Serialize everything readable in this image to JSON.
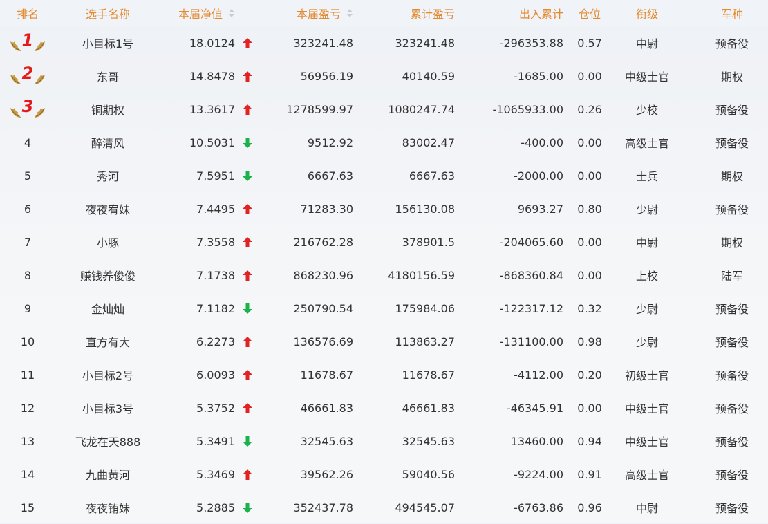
{
  "headers": {
    "rank": "排名",
    "name": "选手名称",
    "nav": "本届净值",
    "current_profit": "本届盈亏",
    "cumulative_profit": "累计盈亏",
    "flow": "出入累计",
    "position": "仓位",
    "military_rank": "衔级",
    "branch": "军种"
  },
  "colors": {
    "accent": "#e48a2e",
    "up": "#e02424",
    "down": "#1bb24b",
    "medal": "#e21a1a"
  },
  "rows": [
    {
      "rank": "1",
      "name": "小目标1号",
      "nav": "18.0124",
      "trend": "up",
      "current_profit": "323241.48",
      "cumulative_profit": "323241.48",
      "flow": "-296353.88",
      "position": "0.57",
      "military_rank": "中尉",
      "branch": "预备役"
    },
    {
      "rank": "2",
      "name": "东哥",
      "nav": "14.8478",
      "trend": "up",
      "current_profit": "56956.19",
      "cumulative_profit": "40140.59",
      "flow": "-1685.00",
      "position": "0.00",
      "military_rank": "中级士官",
      "branch": "期权"
    },
    {
      "rank": "3",
      "name": "铜期权",
      "nav": "13.3617",
      "trend": "up",
      "current_profit": "1278599.97",
      "cumulative_profit": "1080247.74",
      "flow": "-1065933.00",
      "position": "0.26",
      "military_rank": "少校",
      "branch": "预备役"
    },
    {
      "rank": "4",
      "name": "醉清风",
      "nav": "10.5031",
      "trend": "down",
      "current_profit": "9512.92",
      "cumulative_profit": "83002.47",
      "flow": "-400.00",
      "position": "0.00",
      "military_rank": "高级士官",
      "branch": "预备役"
    },
    {
      "rank": "5",
      "name": "秀河",
      "nav": "7.5951",
      "trend": "down",
      "current_profit": "6667.63",
      "cumulative_profit": "6667.63",
      "flow": "-2000.00",
      "position": "0.00",
      "military_rank": "士兵",
      "branch": "期权"
    },
    {
      "rank": "6",
      "name": "夜夜宥妹",
      "nav": "7.4495",
      "trend": "up",
      "current_profit": "71283.30",
      "cumulative_profit": "156130.08",
      "flow": "9693.27",
      "position": "0.80",
      "military_rank": "少尉",
      "branch": "预备役"
    },
    {
      "rank": "7",
      "name": "小豚",
      "nav": "7.3558",
      "trend": "up",
      "current_profit": "216762.28",
      "cumulative_profit": "378901.5",
      "flow": "-204065.60",
      "position": "0.00",
      "military_rank": "中尉",
      "branch": "期权"
    },
    {
      "rank": "8",
      "name": "赚钱养俊俊",
      "nav": "7.1738",
      "trend": "up",
      "current_profit": "868230.96",
      "cumulative_profit": "4180156.59",
      "flow": "-868360.84",
      "position": "0.00",
      "military_rank": "上校",
      "branch": "陆军"
    },
    {
      "rank": "9",
      "name": "金灿灿",
      "nav": "7.1182",
      "trend": "down",
      "current_profit": "250790.54",
      "cumulative_profit": "175984.06",
      "flow": "-122317.12",
      "position": "0.32",
      "military_rank": "少尉",
      "branch": "预备役"
    },
    {
      "rank": "10",
      "name": "直方有大",
      "nav": "6.2273",
      "trend": "up",
      "current_profit": "136576.69",
      "cumulative_profit": "113863.27",
      "flow": "-131100.00",
      "position": "0.98",
      "military_rank": "少尉",
      "branch": "预备役"
    },
    {
      "rank": "11",
      "name": "小目标2号",
      "nav": "6.0093",
      "trend": "up",
      "current_profit": "11678.67",
      "cumulative_profit": "11678.67",
      "flow": "-4112.00",
      "position": "0.20",
      "military_rank": "初级士官",
      "branch": "预备役"
    },
    {
      "rank": "12",
      "name": "小目标3号",
      "nav": "5.3752",
      "trend": "up",
      "current_profit": "46661.83",
      "cumulative_profit": "46661.83",
      "flow": "-46345.91",
      "position": "0.00",
      "military_rank": "中级士官",
      "branch": "预备役"
    },
    {
      "rank": "13",
      "name": "飞龙在天888",
      "nav": "5.3491",
      "trend": "down",
      "current_profit": "32545.63",
      "cumulative_profit": "32545.63",
      "flow": "13460.00",
      "position": "0.94",
      "military_rank": "中级士官",
      "branch": "预备役"
    },
    {
      "rank": "14",
      "name": "九曲黄河",
      "nav": "5.3469",
      "trend": "up",
      "current_profit": "39562.26",
      "cumulative_profit": "59040.56",
      "flow": "-9224.00",
      "position": "0.91",
      "military_rank": "高级士官",
      "branch": "预备役"
    },
    {
      "rank": "15",
      "name": "夜夜铕妹",
      "nav": "5.2885",
      "trend": "down",
      "current_profit": "352437.78",
      "cumulative_profit": "494545.07",
      "flow": "-6763.86",
      "position": "0.96",
      "military_rank": "中尉",
      "branch": "预备役"
    }
  ]
}
